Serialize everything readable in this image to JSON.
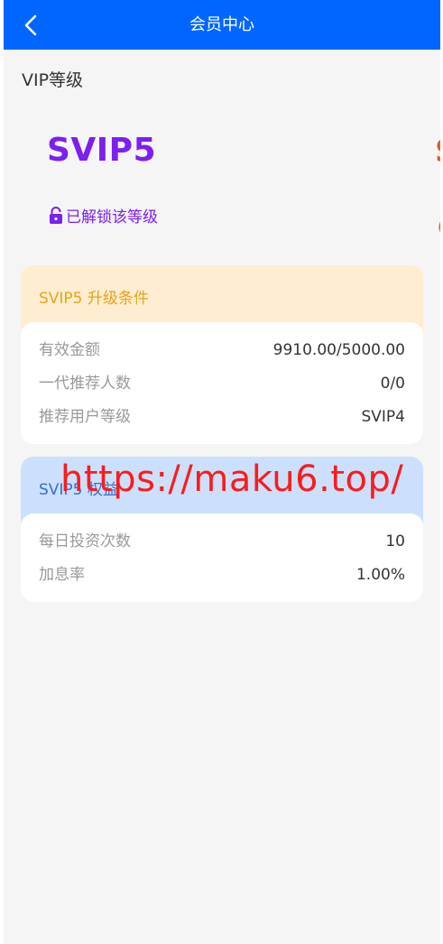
{
  "header": {
    "title": "会员中心",
    "back_icon": "chevron-left-icon"
  },
  "section": {
    "title": "VIP等级"
  },
  "level": {
    "name": "SVIP5",
    "status": "已解锁该等级",
    "status_icon": "lock-open-icon",
    "next_peek": "S",
    "next_peek_sub": "(",
    "accent_color": "#7c1ff0"
  },
  "upgrade_card": {
    "title": "SVIP5 升级条件",
    "rows": [
      {
        "label": "有效金额",
        "value": "9910.00/5000.00"
      },
      {
        "label": "一代推荐人数",
        "value": "0/0"
      },
      {
        "label": "推荐用户等级",
        "value": "SVIP4"
      }
    ]
  },
  "benefit_card": {
    "title": "SVIP5 权益",
    "rows": [
      {
        "label": "每日投资次数",
        "value": "10"
      },
      {
        "label": "加息率",
        "value": "1.00%"
      }
    ]
  },
  "watermark": {
    "text": "https://maku6.top/"
  },
  "colors": {
    "header": "#0066ff",
    "background": "#f5f5f5",
    "upgrade_head": "#feedd0",
    "benefit_head": "#cce0fd"
  }
}
